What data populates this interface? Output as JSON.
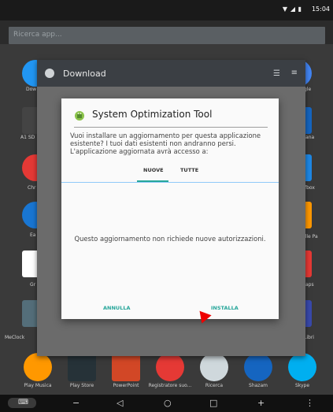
{
  "status_bar": {
    "time": "15:04"
  },
  "search": {
    "placeholder": "Ricerca app..."
  },
  "left_apps": [
    {
      "label": "Dow"
    },
    {
      "label": "A1 SD"
    },
    {
      "label": "Chr"
    },
    {
      "label": "Ea"
    },
    {
      "label": "Gr"
    },
    {
      "label": "MeClock"
    }
  ],
  "right_apps": [
    {
      "label": "gle"
    },
    {
      "label": "tiana"
    },
    {
      "label": "fbox"
    },
    {
      "label": "elle Pa"
    },
    {
      "label": "aps"
    },
    {
      "label": "Libri"
    }
  ],
  "dock_apps": [
    {
      "label": "Play Musica"
    },
    {
      "label": "Play Store"
    },
    {
      "label": "PowerPoint"
    },
    {
      "label": "Registratore suo..."
    },
    {
      "label": "Ricerca"
    },
    {
      "label": "Shazam"
    },
    {
      "label": "Skype"
    }
  ],
  "download_window": {
    "title": "Download"
  },
  "dialog": {
    "title": "System Optimization Tool",
    "message": "Vuoi installare un aggiornamento per questa applicazione esistente? I tuoi dati esistenti non andranno persi. L'applicazione aggiornata avrà accesso a:",
    "tabs": [
      "NUOVE",
      "TUTTE"
    ],
    "no_permissions_text": "Questo aggiornamento non richiede nuove autorizzazioni.",
    "cancel_label": "ANNULLA",
    "install_label": "INSTALLA"
  },
  "navbar": {
    "back_label": "◁",
    "home_label": "○",
    "recents_label": "□",
    "minus_label": "−",
    "plus_label": "+",
    "more_label": "⋮"
  }
}
